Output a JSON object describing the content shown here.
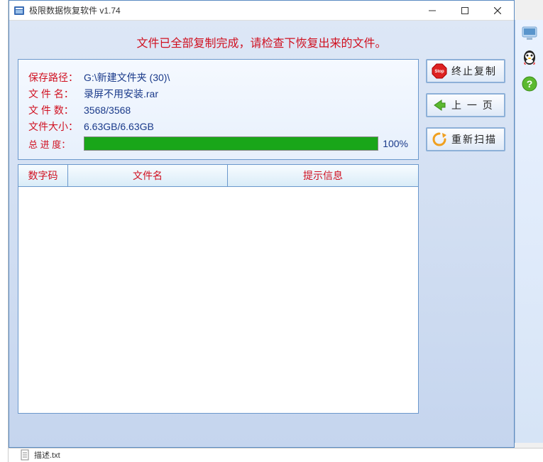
{
  "window": {
    "title": "极限数据恢复软件 v1.74"
  },
  "banner": "文件已全部复制完成，请检查下恢复出来的文件。",
  "info": {
    "path_label": "保存路径：",
    "path": "G:\\新建文件夹 (30)\\",
    "name_label": "文 件 名：",
    "name": "录屏不用安装.rar",
    "count_label": "文 件 数：",
    "count": "3568/3568",
    "size_label": "文件大小：",
    "size": "6.63GB/6.63GB",
    "progress_label": "总 进 度：",
    "progress_pct": "100%"
  },
  "table": {
    "col1": "数字码",
    "col2": "文件名",
    "col3": "提示信息"
  },
  "buttons": {
    "stop": "终止复制",
    "prev": "上 一 页",
    "rescan": "重新扫描"
  },
  "task": {
    "file": "描述.txt"
  }
}
